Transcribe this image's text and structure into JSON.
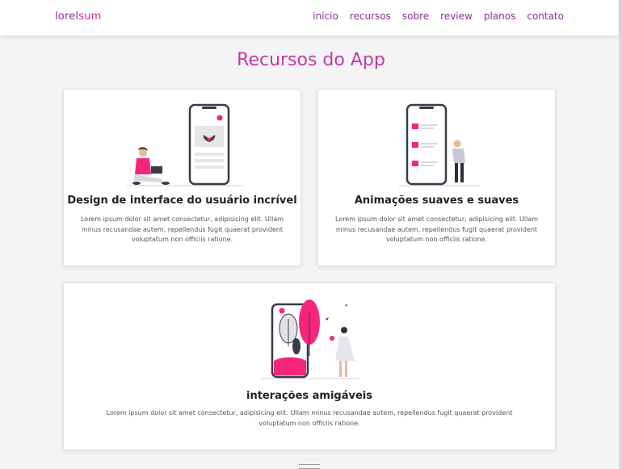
{
  "navbar": {
    "brand_part1": "lorel",
    "brand_part2": "sum",
    "links": [
      "inicio",
      "recursos",
      "sobre",
      "review",
      "planos",
      "contato"
    ]
  },
  "section": {
    "title": "Recursos do App"
  },
  "cards": [
    {
      "title": "Design de interface do usuário incrível",
      "text": "Lorem ipsum dolor sit amet consectetur, adipisicing elit. Ullam minus recusandae autem, repellendus fugit quaerat provident voluptatum non officiis ratione.",
      "icon": "phone-design-illustration"
    },
    {
      "title": "Animações suaves e suaves",
      "text": "Lorem ipsum dolor sit amet consectetur, adipisicing elit. Ullam minus recusandae autem, repellendus fugit quaerat provident voluptatum non officiis ratione.",
      "icon": "phone-animation-illustration"
    },
    {
      "title": "interações amigáveis",
      "text": "Lorem ipsum dolor sit amet consectetur, adipisicing elit. Ullam minus recusandae autem, repellendus fugit quaerat provident voluptatum non officiis ratione.",
      "icon": "phone-interaction-illustration"
    }
  ],
  "colors": {
    "accent": "#e0239a",
    "brand": "#8e2f9b",
    "title": "#c23aa6",
    "background": "#f4f4f4"
  }
}
